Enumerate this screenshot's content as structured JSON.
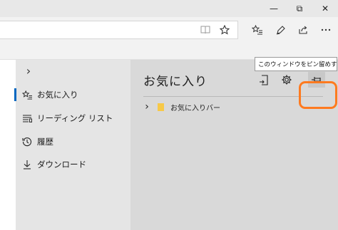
{
  "window": {
    "minimize_glyph": "—",
    "maximize_glyph": "⧉",
    "close_glyph": "✕"
  },
  "toolbar": {
    "icons": [
      "reading-view-icon",
      "favorite-star-icon",
      "hub-icon",
      "web-note-icon",
      "share-icon",
      "more-icon"
    ]
  },
  "hub": {
    "collapse_glyph": "›",
    "nav": [
      {
        "label": "お気に入り",
        "icon": "favorites-star-icon",
        "active": true
      },
      {
        "label": "リーディング リスト",
        "icon": "reading-list-icon",
        "active": false
      },
      {
        "label": "履歴",
        "icon": "history-icon",
        "active": false
      },
      {
        "label": "ダウンロード",
        "icon": "download-icon",
        "active": false
      }
    ],
    "panel": {
      "title": "お気に入り",
      "tree": [
        {
          "label": "お気に入りバー",
          "expand_glyph": "›"
        }
      ]
    },
    "tooltip": "このウィンドウをピン留めする"
  },
  "colors": {
    "accent": "#0067c0",
    "highlight": "#ff7a1f",
    "folder": "#f7c948"
  }
}
